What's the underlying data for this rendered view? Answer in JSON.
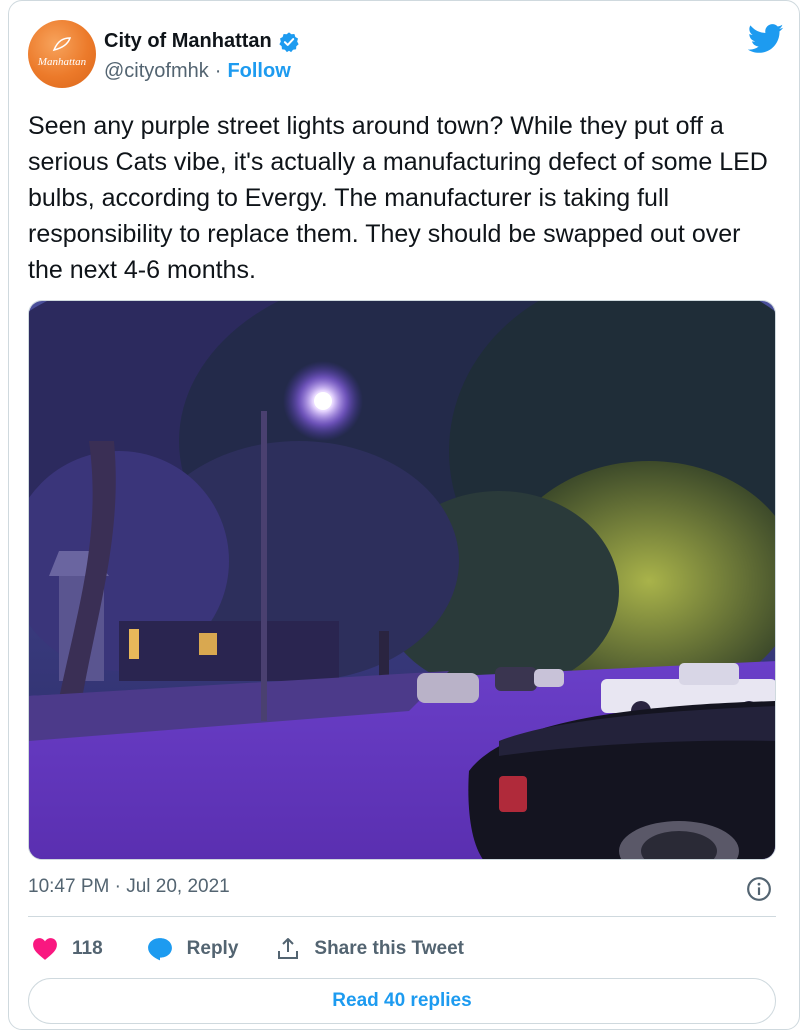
{
  "author": {
    "avatar_text": "Manhattan",
    "name": "City of Manhattan",
    "handle": "@cityofmhk",
    "separator": "·",
    "follow_label": "Follow"
  },
  "tweet": {
    "text": "Seen any purple street lights around town? While they put off a serious Cats vibe, it's actually a manufacturing defect of some LED bulbs, according to Evergy. The manufacturer is taking full responsibility to replace them. They should be swapped out over the next 4-6 months.",
    "timestamp": "10:47 PM · Jul 20, 2021"
  },
  "actions": {
    "like_count": "118",
    "reply_label": "Reply",
    "share_label": "Share this Tweet"
  },
  "footer": {
    "read_replies_label": "Read 40 replies"
  },
  "colors": {
    "accent": "#1d9bf0",
    "like": "#f91880",
    "muted": "#536471",
    "text": "#0f1419",
    "border": "#cfd9de"
  },
  "icons": [
    "twitter-bird-icon",
    "verified-badge-icon",
    "info-icon",
    "heart-icon",
    "reply-bubble-icon",
    "share-icon"
  ]
}
